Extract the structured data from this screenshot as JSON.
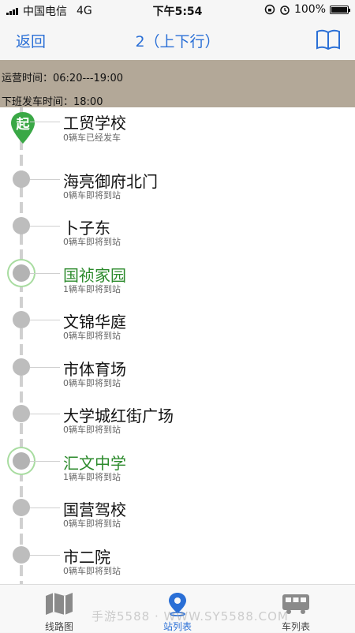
{
  "status_bar": {
    "carrier": "中国电信",
    "network": "4G",
    "time": "下午5:54",
    "battery": "100%"
  },
  "nav": {
    "back_label": "返回",
    "title": "2（上下行）",
    "book_icon": "book-icon"
  },
  "info": {
    "operating_hours": "运营时间：06:20---19:00",
    "last_departure": "下班发车时间：18:00"
  },
  "start_badge": "起",
  "colors": {
    "accent": "#2a6fd6",
    "active_station": "#2b8a2b",
    "info_bg": "#b3a898"
  },
  "stations": [
    {
      "name": "工贸学校",
      "status": "0辆车已经发车",
      "active": false
    },
    {
      "name": "海亮御府北门",
      "status": "0辆车即将到站",
      "active": false
    },
    {
      "name": "卜子东",
      "status": "0辆车即将到站",
      "active": false
    },
    {
      "name": "国祯家园",
      "status": "1辆车即将到站",
      "active": true
    },
    {
      "name": "文锦华庭",
      "status": "0辆车即将到站",
      "active": false
    },
    {
      "name": "市体育场",
      "status": "0辆车即将到站",
      "active": false
    },
    {
      "name": "大学城红街广场",
      "status": "0辆车即将到站",
      "active": false
    },
    {
      "name": "汇文中学",
      "status": "1辆车即将到站",
      "active": true
    },
    {
      "name": "国营驾校",
      "status": "0辆车即将到站",
      "active": false
    },
    {
      "name": "市二院",
      "status": "0辆车即将到站",
      "active": false
    }
  ],
  "tabs": [
    {
      "label": "线路图",
      "icon": "map-icon",
      "active": false
    },
    {
      "label": "站列表",
      "icon": "location-pin-icon",
      "active": true
    },
    {
      "label": "车列表",
      "icon": "bus-icon",
      "active": false
    }
  ],
  "watermark": "手游5588 · WWW.SY5588.COM"
}
